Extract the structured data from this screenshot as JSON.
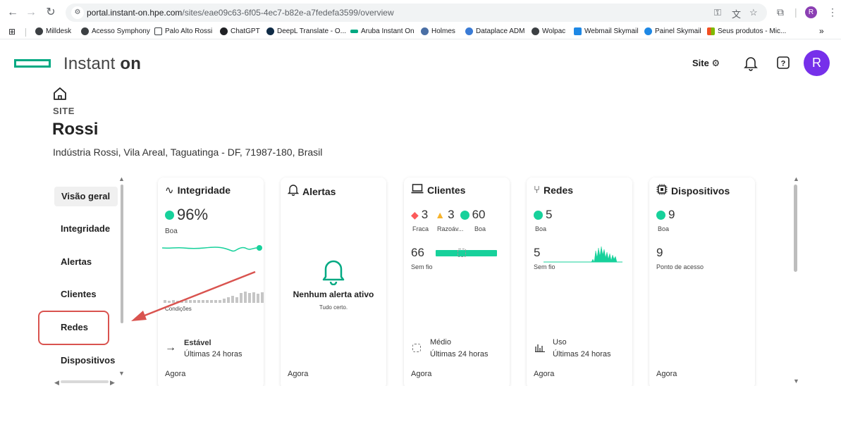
{
  "browser": {
    "url_host": "portal.instant-on.hpe.com",
    "url_path": "/sites/eae09c63-6f05-4ec7-b82e-a7fedefa3599/overview",
    "profile_initial": "R",
    "bookmarks": [
      {
        "label": "Milldesk"
      },
      {
        "label": "Acesso Symphony"
      },
      {
        "label": "Palo Alto Rossi"
      },
      {
        "label": "ChatGPT"
      },
      {
        "label": "DeepL Translate - O..."
      },
      {
        "label": "Aruba Instant On"
      },
      {
        "label": "Holmes"
      },
      {
        "label": "Dataplace ADM"
      },
      {
        "label": "Wolpac"
      },
      {
        "label": "Webmail Skymail"
      },
      {
        "label": "Painel Skymail"
      },
      {
        "label": "Seus produtos - Mic..."
      }
    ],
    "more_bookmarks": "»"
  },
  "app": {
    "brand_text": "Instant",
    "brand_suffix": "on",
    "header_site": "Site",
    "avatar_initial": "R"
  },
  "site": {
    "label": "SITE",
    "name": "Rossi",
    "address": "Indústria Rossi, Vila Areal, Taguatinga - DF, 71987-180, Brasil"
  },
  "nav": {
    "items": [
      {
        "label": "Visão geral"
      },
      {
        "label": "Integridade"
      },
      {
        "label": "Alertas"
      },
      {
        "label": "Clientes"
      },
      {
        "label": "Redes"
      },
      {
        "label": "Dispositivos"
      }
    ]
  },
  "cards": {
    "integridade": {
      "title": "Integridade",
      "value": "96%",
      "status": "Boa",
      "conditions_label": "Condições",
      "foot_title": "Estável",
      "foot_sub": "Últimas 24 horas",
      "time": "Agora"
    },
    "alertas": {
      "title": "Alertas",
      "empty_title": "Nenhum alerta ativo",
      "empty_sub": "Tudo certo.",
      "time": "Agora"
    },
    "clientes": {
      "title": "Clientes",
      "weak_count": "3",
      "weak_label": "Fraca",
      "fair_count": "3",
      "fair_label": "Razoáv...",
      "good_count": "60",
      "good_label": "Boa",
      "wireless_count": "66",
      "wireless_label": "Sem fio",
      "foot_title": "Médio",
      "foot_sub": "Últimas 24 horas",
      "time": "Agora"
    },
    "redes": {
      "title": "Redes",
      "count": "5",
      "status": "Boa",
      "wireless_count": "5",
      "wireless_label": "Sem fio",
      "foot_title": "Uso",
      "foot_sub": "Últimas 24 horas",
      "time": "Agora"
    },
    "dispositivos": {
      "title": "Dispositivos",
      "count": "9",
      "status": "Boa",
      "ap_count": "9",
      "ap_label": "Ponto de acesso",
      "time": "Agora"
    }
  },
  "colors": {
    "good": "#17d19b",
    "weak": "#fc5a5a",
    "fair": "#f7b32b",
    "brand": "#01a982",
    "avatar": "#7630ea",
    "annotation": "#d9534f"
  }
}
